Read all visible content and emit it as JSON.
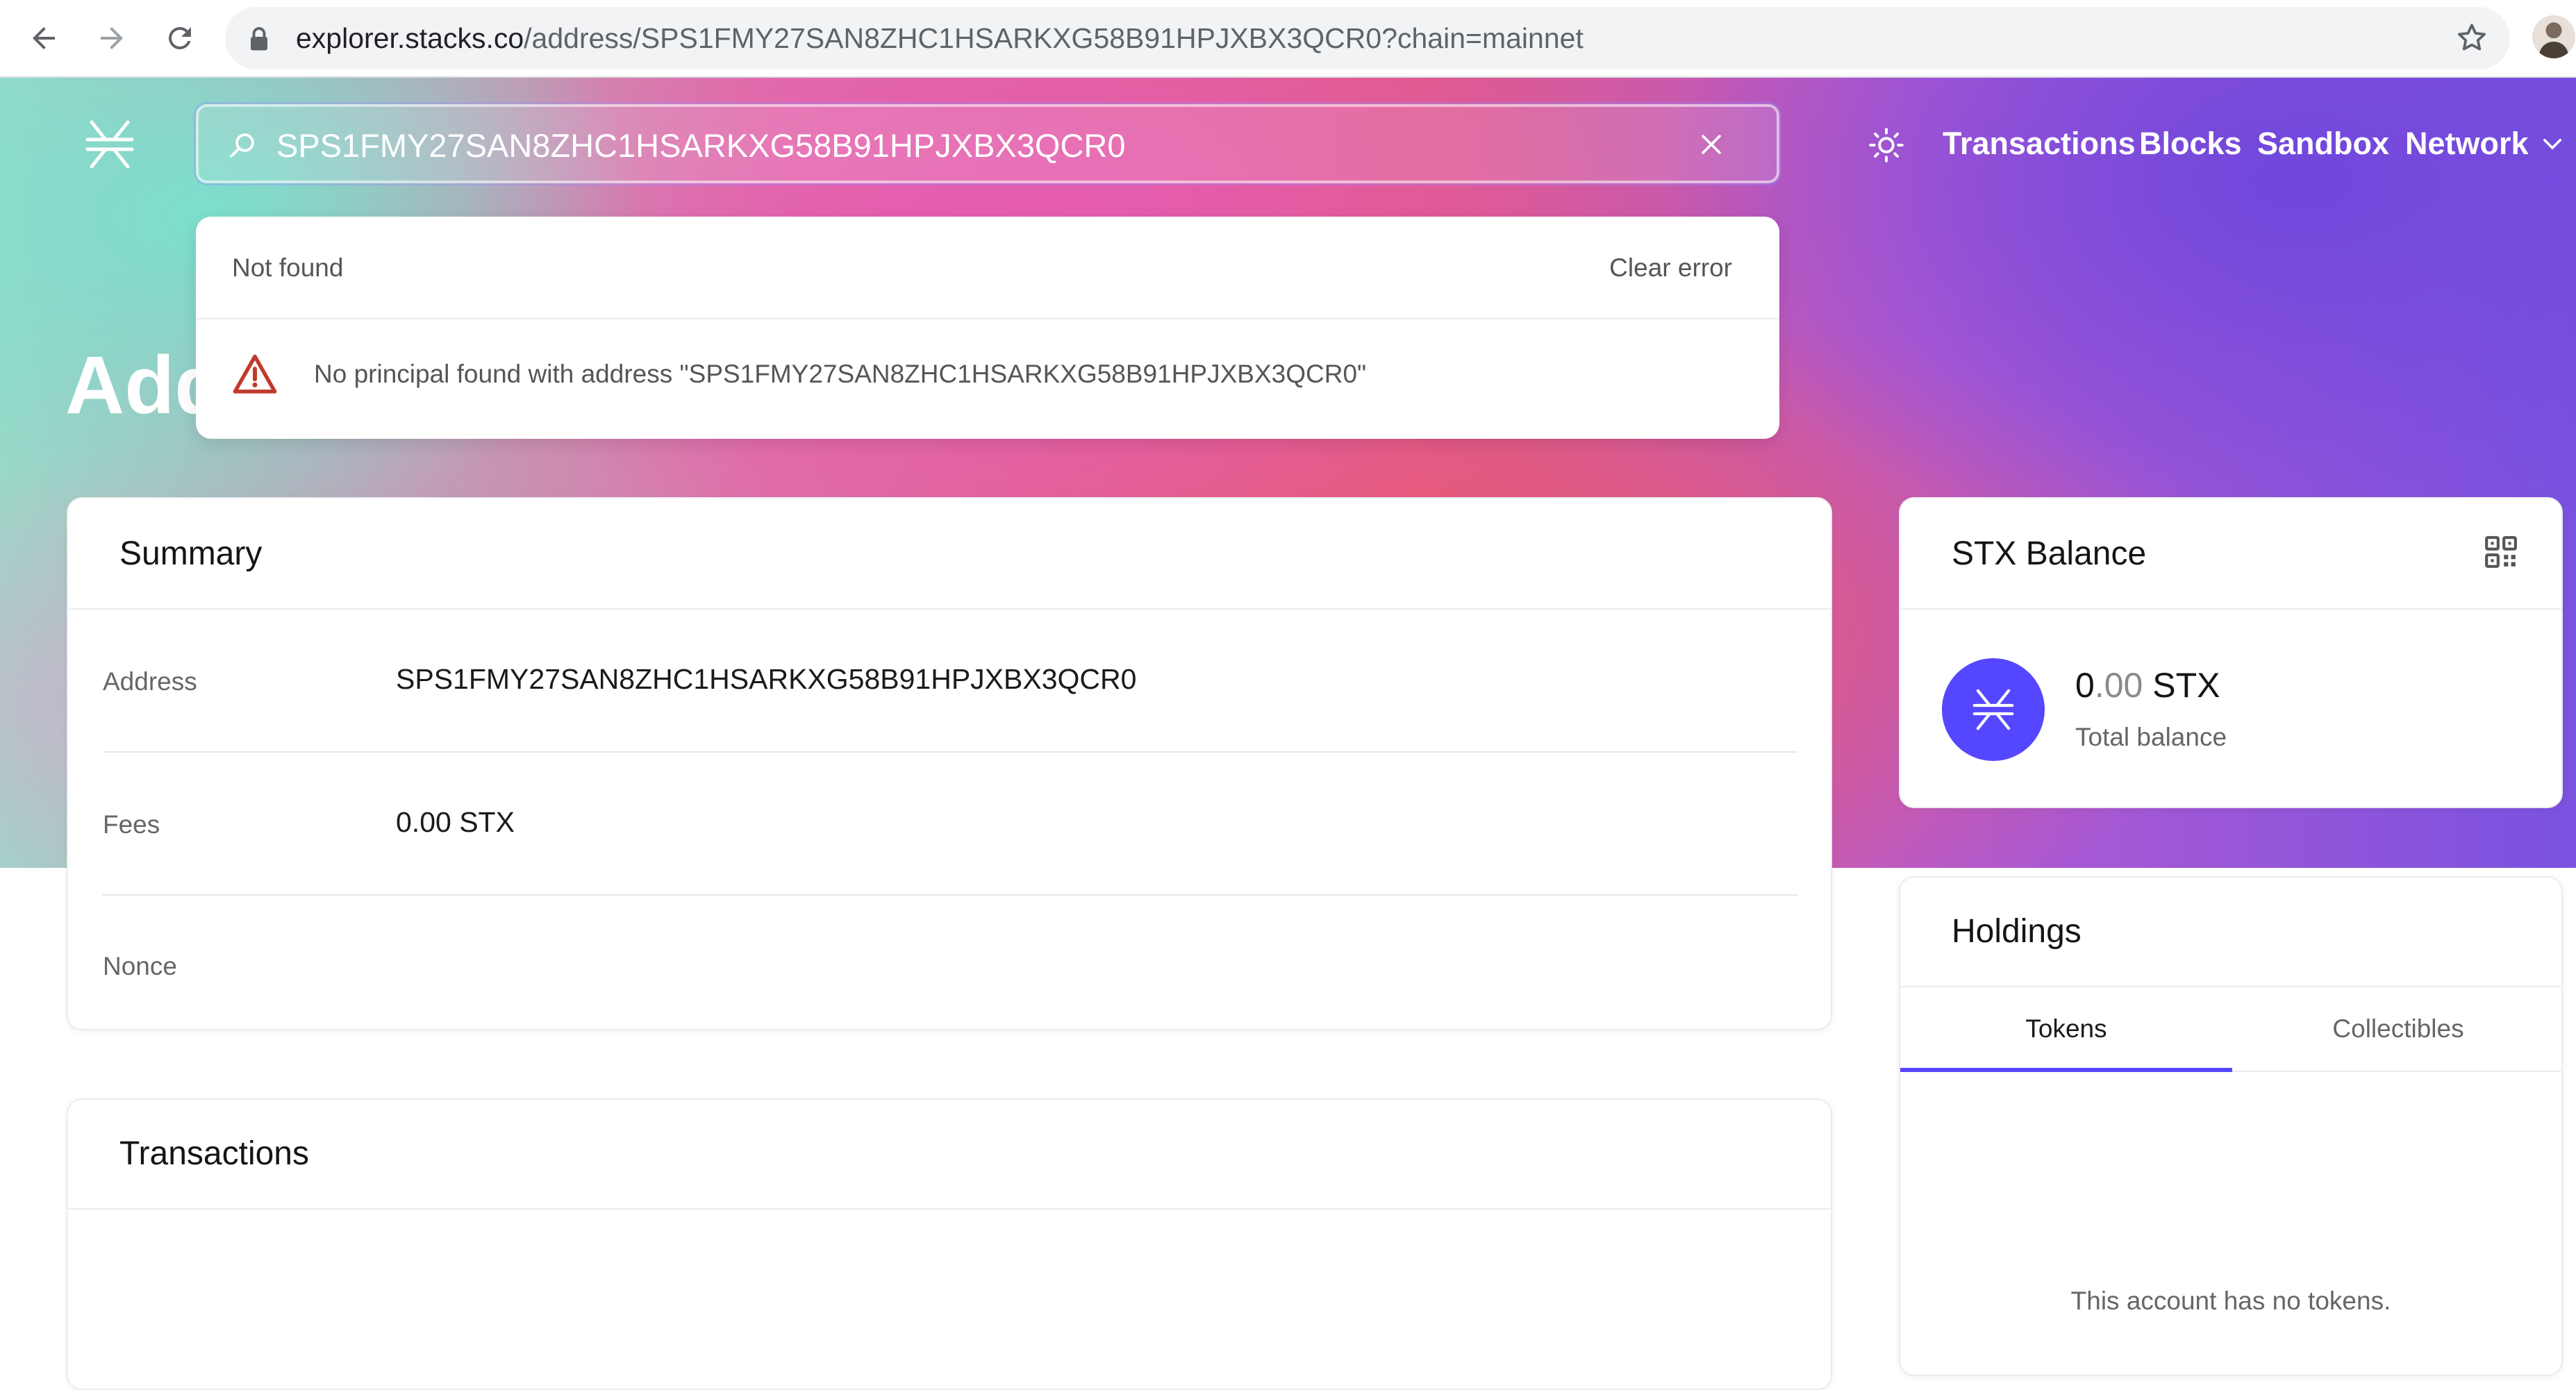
{
  "browser": {
    "url_host": "explorer.stacks.co",
    "url_rest": "/address/SPS1FMY27SAN8ZHC1HSARKXG58B91HPJXBX3QCR0?chain=mainnet"
  },
  "header": {
    "search_value": "SPS1FMY27SAN8ZHC1HSARKXG58B91HPJXBX3QCR0",
    "nav": {
      "transactions": "Transactions",
      "blocks": "Blocks",
      "sandbox": "Sandbox",
      "network": "Network"
    }
  },
  "page": {
    "heading": "Address"
  },
  "search_error": {
    "title": "Not found",
    "clear_label": "Clear error",
    "message": "No principal found with address \"SPS1FMY27SAN8ZHC1HSARKXG58B91HPJXBX3QCR0\""
  },
  "summary": {
    "title": "Summary",
    "rows": [
      {
        "label": "Address",
        "value": "SPS1FMY27SAN8ZHC1HSARKXG58B91HPJXBX3QCR0"
      },
      {
        "label": "Fees",
        "value": "0.00 STX"
      },
      {
        "label": "Nonce",
        "value": ""
      }
    ]
  },
  "balance": {
    "title": "STX Balance",
    "amount_whole": "0",
    "amount_decimals": ".00",
    "amount_unit": " STX",
    "caption": "Total balance"
  },
  "holdings": {
    "title": "Holdings",
    "tabs": [
      {
        "label": "Tokens",
        "active": true
      },
      {
        "label": "Collectibles",
        "active": false
      }
    ],
    "empty_message": "This account has no tokens."
  },
  "transactions": {
    "title": "Transactions"
  },
  "colors": {
    "accent": "#5546ff",
    "error": "#c0392b"
  },
  "icons": [
    "back-arrow-icon",
    "forward-arrow-icon",
    "reload-icon",
    "lock-icon",
    "star-icon",
    "stacks-logo-icon",
    "search-icon",
    "close-icon",
    "sun-icon",
    "chevron-down-icon",
    "warning-icon",
    "qr-code-icon"
  ]
}
